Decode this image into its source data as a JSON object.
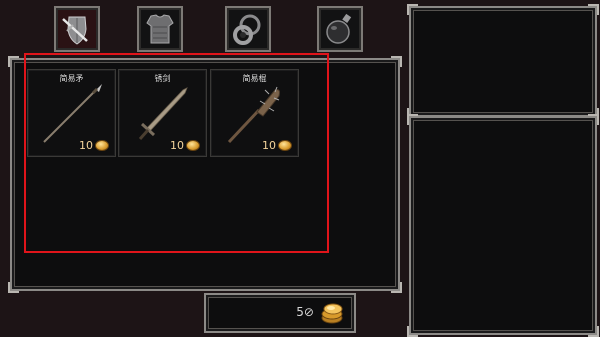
{
  "tabs": [
    {
      "name": "weapon",
      "icon": "sword-shield-icon",
      "active": true
    },
    {
      "name": "armor",
      "icon": "chest-armor-icon",
      "active": false
    },
    {
      "name": "accessory",
      "icon": "ring-icon",
      "active": false
    },
    {
      "name": "consumable",
      "icon": "potion-icon",
      "active": false
    }
  ],
  "shop": {
    "items": [
      {
        "name": "简易矛",
        "price": "10",
        "icon": "spear-icon"
      },
      {
        "name": "锈剑",
        "price": "10",
        "icon": "rusty-sword-icon"
      },
      {
        "name": "简易棍",
        "price": "10",
        "icon": "spiked-club-icon"
      }
    ]
  },
  "gold": {
    "amount": "5⊘",
    "icon": "gold-coins-icon"
  },
  "colors": {
    "highlight": "#e0141a",
    "price_text": "#f4d49c",
    "panel_border": "#8c8a87"
  }
}
